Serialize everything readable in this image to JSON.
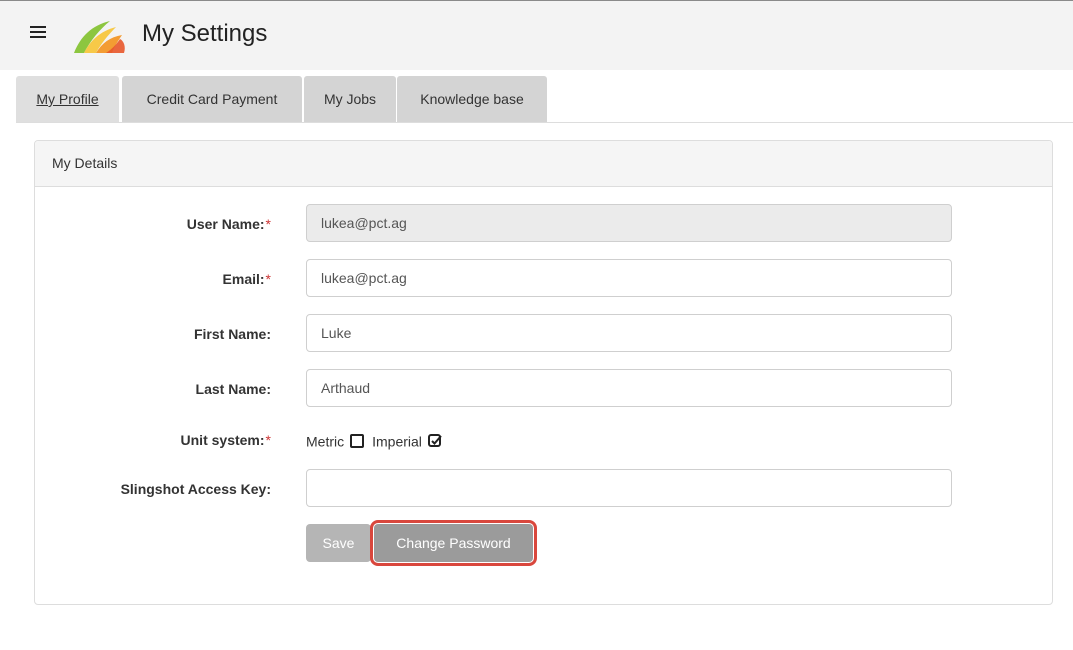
{
  "header": {
    "title": "My Settings"
  },
  "tabs": [
    {
      "label": "My Profile",
      "active": true
    },
    {
      "label": "Credit Card Payment",
      "active": false
    },
    {
      "label": "My Jobs",
      "active": false
    },
    {
      "label": "Knowledge base",
      "active": false
    }
  ],
  "panel": {
    "title": "My Details"
  },
  "form": {
    "username": {
      "label": "User Name:",
      "required_mark": "*",
      "value": "lukea@pct.ag"
    },
    "email": {
      "label": "Email:",
      "required_mark": "*",
      "value": "lukea@pct.ag"
    },
    "first_name": {
      "label": "First Name:",
      "value": "Luke"
    },
    "last_name": {
      "label": "Last Name:",
      "value": "Arthaud"
    },
    "unit_system": {
      "label": "Unit system:",
      "required_mark": "*",
      "metric_label": "Metric",
      "metric_checked": false,
      "imperial_label": "Imperial",
      "imperial_checked": true
    },
    "slingshot": {
      "label": "Slingshot Access Key:",
      "value": ""
    }
  },
  "buttons": {
    "save": "Save",
    "change_password": "Change Password"
  },
  "colors": {
    "highlight": "#d9473d",
    "required": "#cc3333"
  },
  "icons": {
    "menu": "hamburger-icon",
    "logo": "app-logo",
    "checkbox_empty": "checkbox-empty-icon",
    "checkbox_checked": "checkbox-checked-icon"
  }
}
